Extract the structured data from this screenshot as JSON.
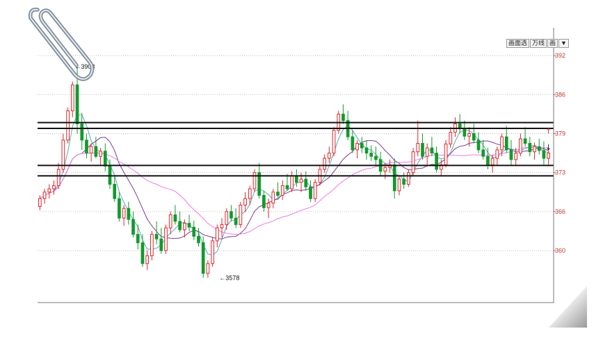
{
  "toolbar": {
    "buttons": [
      "画面选",
      "万线",
      "画",
      "▼"
    ]
  },
  "chart_data": {
    "type": "candlestick",
    "ylim": [
      3540,
      3950
    ],
    "y_ticks": [
      "392",
      "386",
      "379",
      "373",
      "366",
      "360"
    ],
    "y_tick_values": [
      3920,
      3860,
      3800,
      3740,
      3680,
      3620
    ],
    "annotations": [
      {
        "text": "3903",
        "index": 7,
        "value": 3903
      },
      {
        "text": "3578",
        "index": 38,
        "value": 3578
      }
    ],
    "levels": [
      3817,
      3808,
      3751,
      3735
    ],
    "candles": [
      [
        3688,
        3705,
        3682,
        3700
      ],
      [
        3700,
        3715,
        3692,
        3710
      ],
      [
        3710,
        3722,
        3700,
        3715
      ],
      [
        3715,
        3728,
        3706,
        3720
      ],
      [
        3720,
        3755,
        3715,
        3745
      ],
      [
        3745,
        3800,
        3740,
        3790
      ],
      [
        3790,
        3840,
        3785,
        3835
      ],
      [
        3835,
        3880,
        3825,
        3875
      ],
      [
        3875,
        3903,
        3800,
        3815
      ],
      [
        3815,
        3832,
        3775,
        3790
      ],
      [
        3790,
        3800,
        3762,
        3770
      ],
      [
        3770,
        3785,
        3757,
        3780
      ],
      [
        3780,
        3795,
        3762,
        3765
      ],
      [
        3765,
        3778,
        3750,
        3773
      ],
      [
        3773,
        3785,
        3742,
        3750
      ],
      [
        3750,
        3760,
        3715,
        3722
      ],
      [
        3722,
        3735,
        3695,
        3700
      ],
      [
        3700,
        3710,
        3665,
        3670
      ],
      [
        3670,
        3690,
        3658,
        3685
      ],
      [
        3685,
        3695,
        3660,
        3668
      ],
      [
        3668,
        3680,
        3640,
        3645
      ],
      [
        3645,
        3660,
        3622,
        3632
      ],
      [
        3632,
        3645,
        3595,
        3600
      ],
      [
        3600,
        3620,
        3590,
        3612
      ],
      [
        3612,
        3650,
        3605,
        3645
      ],
      [
        3645,
        3665,
        3630,
        3638
      ],
      [
        3638,
        3655,
        3615,
        3620
      ],
      [
        3620,
        3660,
        3615,
        3655
      ],
      [
        3655,
        3680,
        3645,
        3675
      ],
      [
        3675,
        3690,
        3660,
        3665
      ],
      [
        3665,
        3680,
        3648,
        3652
      ],
      [
        3652,
        3668,
        3640,
        3662
      ],
      [
        3662,
        3675,
        3650,
        3656
      ],
      [
        3656,
        3666,
        3636,
        3642
      ],
      [
        3642,
        3655,
        3626,
        3632
      ],
      [
        3632,
        3642,
        3578,
        3585
      ],
      [
        3585,
        3605,
        3578,
        3600
      ],
      [
        3600,
        3640,
        3595,
        3635
      ],
      [
        3635,
        3660,
        3625,
        3655
      ],
      [
        3655,
        3670,
        3640,
        3660
      ],
      [
        3660,
        3685,
        3652,
        3680
      ],
      [
        3680,
        3690,
        3665,
        3670
      ],
      [
        3670,
        3685,
        3655,
        3660
      ],
      [
        3660,
        3695,
        3655,
        3690
      ],
      [
        3690,
        3710,
        3680,
        3700
      ],
      [
        3700,
        3720,
        3690,
        3715
      ],
      [
        3715,
        3745,
        3710,
        3740
      ],
      [
        3740,
        3755,
        3700,
        3705
      ],
      [
        3705,
        3712,
        3680,
        3686
      ],
      [
        3686,
        3700,
        3670,
        3693
      ],
      [
        3693,
        3715,
        3685,
        3710
      ],
      [
        3710,
        3725,
        3702,
        3705
      ],
      [
        3705,
        3728,
        3698,
        3720
      ],
      [
        3720,
        3738,
        3712,
        3715
      ],
      [
        3715,
        3742,
        3710,
        3735
      ],
      [
        3735,
        3745,
        3718,
        3725
      ],
      [
        3725,
        3740,
        3710,
        3730
      ],
      [
        3730,
        3742,
        3712,
        3718
      ],
      [
        3718,
        3728,
        3695,
        3700
      ],
      [
        3700,
        3730,
        3695,
        3725
      ],
      [
        3725,
        3750,
        3720,
        3745
      ],
      [
        3745,
        3768,
        3740,
        3762
      ],
      [
        3762,
        3780,
        3755,
        3770
      ],
      [
        3770,
        3810,
        3765,
        3805
      ],
      [
        3805,
        3835,
        3800,
        3830
      ],
      [
        3830,
        3845,
        3815,
        3820
      ],
      [
        3820,
        3835,
        3790,
        3795
      ],
      [
        3795,
        3805,
        3770,
        3775
      ],
      [
        3775,
        3790,
        3762,
        3785
      ],
      [
        3785,
        3795,
        3770,
        3778
      ],
      [
        3778,
        3790,
        3760,
        3770
      ],
      [
        3770,
        3782,
        3758,
        3765
      ],
      [
        3765,
        3780,
        3750,
        3760
      ],
      [
        3760,
        3772,
        3735,
        3742
      ],
      [
        3742,
        3755,
        3730,
        3748
      ],
      [
        3748,
        3760,
        3740,
        3752
      ],
      [
        3752,
        3762,
        3700,
        3712
      ],
      [
        3712,
        3735,
        3705,
        3730
      ],
      [
        3730,
        3740,
        3715,
        3722
      ],
      [
        3722,
        3745,
        3718,
        3740
      ],
      [
        3740,
        3778,
        3735,
        3772
      ],
      [
        3772,
        3820,
        3765,
        3785
      ],
      [
        3785,
        3800,
        3760,
        3765
      ],
      [
        3765,
        3785,
        3750,
        3778
      ],
      [
        3778,
        3795,
        3765,
        3770
      ],
      [
        3770,
        3780,
        3740,
        3745
      ],
      [
        3745,
        3760,
        3735,
        3752
      ],
      [
        3752,
        3790,
        3748,
        3784
      ],
      [
        3784,
        3810,
        3778,
        3802
      ],
      [
        3802,
        3825,
        3795,
        3815
      ],
      [
        3815,
        3830,
        3800,
        3808
      ],
      [
        3808,
        3820,
        3790,
        3796
      ],
      [
        3796,
        3810,
        3780,
        3800
      ],
      [
        3800,
        3815,
        3785,
        3790
      ],
      [
        3790,
        3802,
        3770,
        3775
      ],
      [
        3775,
        3790,
        3760,
        3765
      ],
      [
        3765,
        3778,
        3745,
        3752
      ],
      [
        3752,
        3768,
        3740,
        3762
      ],
      [
        3762,
        3780,
        3752,
        3775
      ],
      [
        3775,
        3800,
        3765,
        3795
      ],
      [
        3795,
        3812,
        3770,
        3775
      ],
      [
        3775,
        3790,
        3752,
        3760
      ],
      [
        3760,
        3778,
        3750,
        3770
      ],
      [
        3770,
        3800,
        3765,
        3792
      ],
      [
        3792,
        3810,
        3780,
        3785
      ],
      [
        3785,
        3795,
        3765,
        3772
      ],
      [
        3772,
        3786,
        3760,
        3780
      ],
      [
        3780,
        3792,
        3768,
        3774
      ],
      [
        3774,
        3788,
        3752,
        3762
      ],
      [
        3762,
        3778,
        3750,
        3770
      ]
    ]
  }
}
